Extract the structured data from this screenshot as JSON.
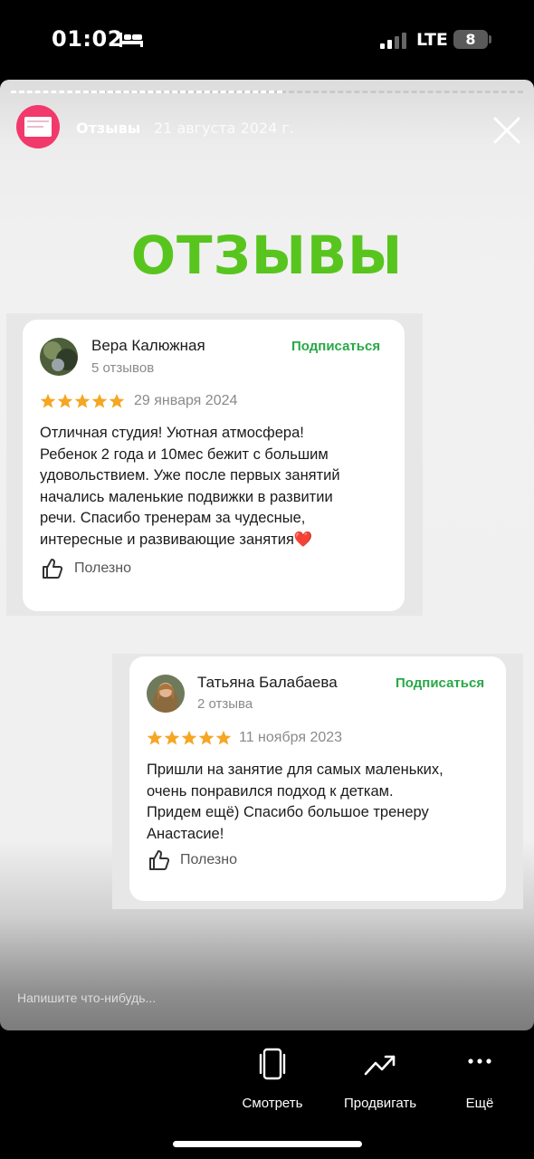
{
  "status_bar": {
    "time": "01:02",
    "network": "LTE",
    "battery": "8"
  },
  "story": {
    "account": "Отзывы",
    "date": "21 августа 2024 г.",
    "title": "ОТЗЫВЫ",
    "reply_placeholder": "Напишите что-нибудь..."
  },
  "reviews": [
    {
      "name": "Вера Калюжная",
      "count": "5 отзывов",
      "subscribe": "Подписаться",
      "rating": 5,
      "date": "29 января 2024",
      "text": "Отличная студия! Уютная атмосфера!\nРебенок 2 года и 10мес бежит с большим\nудовольствием. Уже после первых занятий\nначались маленькие подвижки в развитии\nречи. Спасибо тренерам за чудесные,\nинтересные и развивающие занятия",
      "emoji": "❤️",
      "useful": "Полезно"
    },
    {
      "name": "Татьяна Балабаева",
      "count": "2 отзыва",
      "subscribe": "Подписаться",
      "rating": 5,
      "date": "11 ноября 2023",
      "text": "Пришли на занятие для самых маленьких,\nочень понравился подход к деткам.\nПридем ещё) Спасибо большое тренеру\nАнастасие!",
      "useful": "Полезно"
    }
  ],
  "bottom_bar": {
    "actions": [
      {
        "label": "Смотреть",
        "icon": "device-icon"
      },
      {
        "label": "Продвигать",
        "icon": "trending-up-icon"
      },
      {
        "label": "Ещё",
        "icon": "more-dots-icon"
      }
    ]
  },
  "colors": {
    "title_green": "#58c51e",
    "subscribe_green": "#29a847",
    "star": "#f5a623",
    "avatar_pink": "#f2396b"
  }
}
